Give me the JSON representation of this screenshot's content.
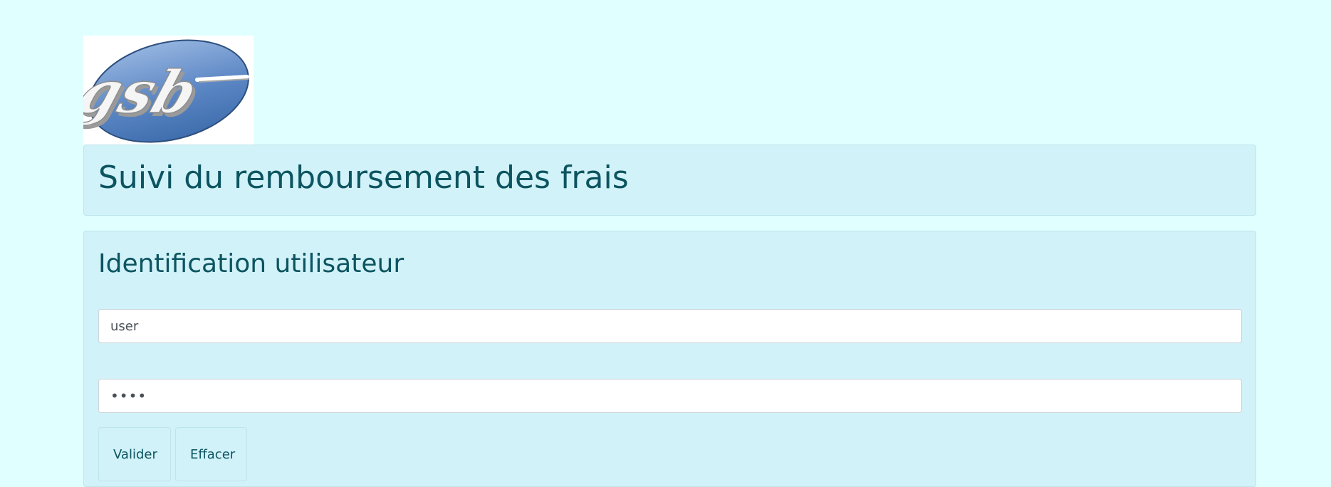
{
  "logo": {
    "text": "gsb"
  },
  "header": {
    "title": "Suivi du remboursement des frais"
  },
  "login": {
    "title": "Identification utilisateur",
    "username_value": "user",
    "password_value": "••••",
    "validate_label": "Valider",
    "clear_label": "Effacer"
  },
  "colors": {
    "page_background": "#e0ffff",
    "panel_background": "#d1f2f8",
    "panel_border": "#bee5eb",
    "text": "#0c5460",
    "logo_blue": "#5a86c3"
  }
}
